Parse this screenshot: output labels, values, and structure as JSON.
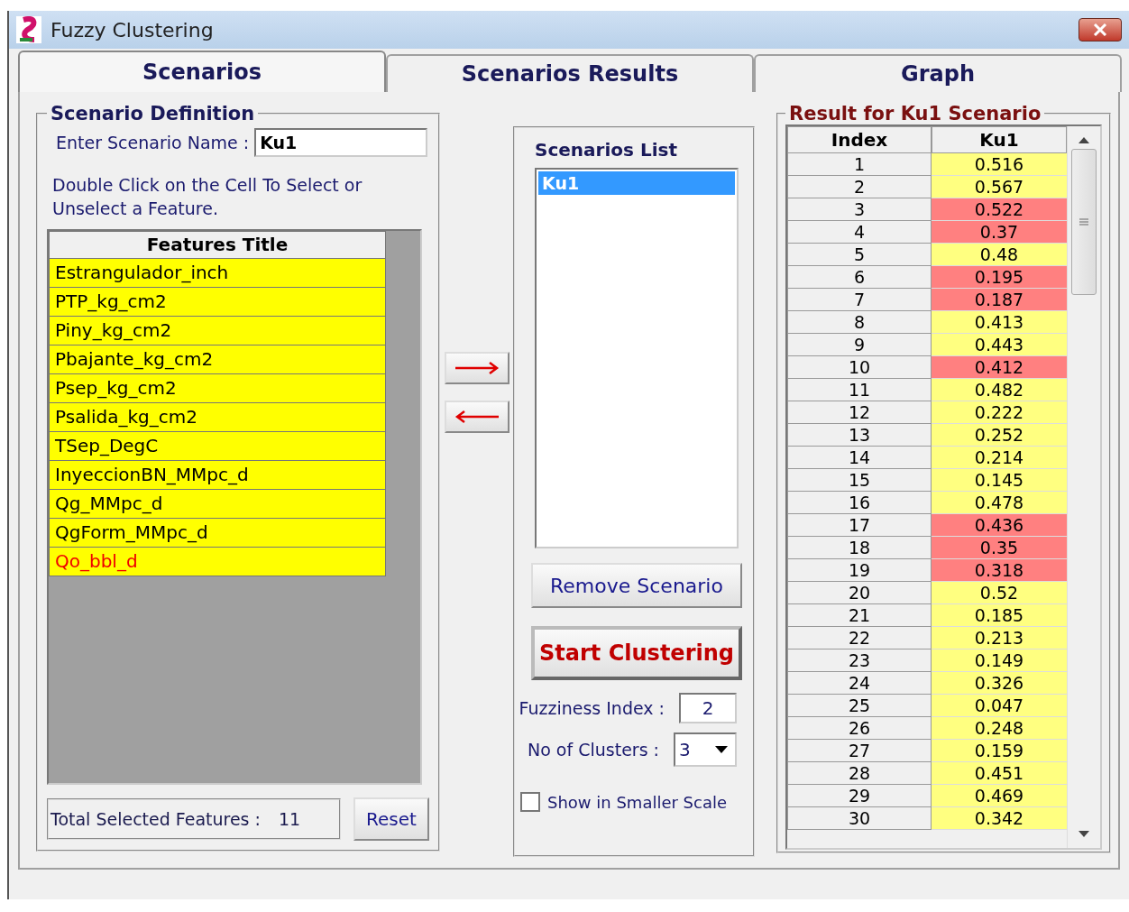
{
  "window": {
    "title": "Fuzzy Clustering"
  },
  "tabs": [
    {
      "label": "Scenarios",
      "selected": true
    },
    {
      "label": "Scenarios Results",
      "selected": false
    },
    {
      "label": "Graph",
      "selected": false
    }
  ],
  "scenario_definition": {
    "title": "Scenario Definition",
    "name_label": "Enter Scenario Name :",
    "name_value": "Ku1",
    "hint": "Double Click on the Cell To Select or Unselect a Feature.",
    "features_header": "Features Title",
    "features": [
      {
        "label": "Estrangulador_inch",
        "target": false
      },
      {
        "label": "PTP_kg_cm2",
        "target": false
      },
      {
        "label": "Piny_kg_cm2",
        "target": false
      },
      {
        "label": "Pbajante_kg_cm2",
        "target": false
      },
      {
        "label": "Psep_kg_cm2",
        "target": false
      },
      {
        "label": "Psalida_kg_cm2",
        "target": false
      },
      {
        "label": "TSep_DegC",
        "target": false
      },
      {
        "label": "InyeccionBN_MMpc_d",
        "target": false
      },
      {
        "label": "Qg_MMpc_d",
        "target": false
      },
      {
        "label": "QgForm_MMpc_d",
        "target": false
      },
      {
        "label": "Qo_bbl_d",
        "target": true
      }
    ],
    "total_label": "Total Selected Features :",
    "total_value": "11",
    "reset_button": "Reset"
  },
  "scenarios_list": {
    "title": "Scenarios List",
    "items": [
      {
        "label": "Ku1",
        "selected": true
      }
    ],
    "remove_button": "Remove Scenario",
    "start_button": "Start Clustering",
    "fuzziness_label": "Fuzziness Index :",
    "fuzziness_value": "2",
    "clusters_label": "No of Clusters :",
    "clusters_value": "3",
    "smaller_scale": {
      "label": "Show in Smaller Scale",
      "checked": false
    }
  },
  "result": {
    "title": "Result for Ku1 Scenario",
    "columns": [
      "Index",
      "Ku1"
    ],
    "rows": [
      {
        "index": "1",
        "value": "0.516",
        "color": "#ffff80"
      },
      {
        "index": "2",
        "value": "0.567",
        "color": "#ffff80"
      },
      {
        "index": "3",
        "value": "0.522",
        "color": "#ff8080"
      },
      {
        "index": "4",
        "value": "0.37",
        "color": "#ff8080"
      },
      {
        "index": "5",
        "value": "0.48",
        "color": "#ffff80"
      },
      {
        "index": "6",
        "value": "0.195",
        "color": "#ff8080"
      },
      {
        "index": "7",
        "value": "0.187",
        "color": "#ff8080"
      },
      {
        "index": "8",
        "value": "0.413",
        "color": "#ffff80"
      },
      {
        "index": "9",
        "value": "0.443",
        "color": "#ffff80"
      },
      {
        "index": "10",
        "value": "0.412",
        "color": "#ff8080"
      },
      {
        "index": "11",
        "value": "0.482",
        "color": "#ffff80"
      },
      {
        "index": "12",
        "value": "0.222",
        "color": "#ffff80"
      },
      {
        "index": "13",
        "value": "0.252",
        "color": "#ffff80"
      },
      {
        "index": "14",
        "value": "0.214",
        "color": "#ffff80"
      },
      {
        "index": "15",
        "value": "0.145",
        "color": "#ffff80"
      },
      {
        "index": "16",
        "value": "0.478",
        "color": "#ffff80"
      },
      {
        "index": "17",
        "value": "0.436",
        "color": "#ff8080"
      },
      {
        "index": "18",
        "value": "0.35",
        "color": "#ff8080"
      },
      {
        "index": "19",
        "value": "0.318",
        "color": "#ff8080"
      },
      {
        "index": "20",
        "value": "0.52",
        "color": "#ffff80"
      },
      {
        "index": "21",
        "value": "0.185",
        "color": "#ffff80"
      },
      {
        "index": "22",
        "value": "0.213",
        "color": "#ffff80"
      },
      {
        "index": "23",
        "value": "0.149",
        "color": "#ffff80"
      },
      {
        "index": "24",
        "value": "0.326",
        "color": "#ffff80"
      },
      {
        "index": "25",
        "value": "0.047",
        "color": "#ffff80"
      },
      {
        "index": "26",
        "value": "0.248",
        "color": "#ffff80"
      },
      {
        "index": "27",
        "value": "0.159",
        "color": "#ffff80"
      },
      {
        "index": "28",
        "value": "0.451",
        "color": "#ffff80"
      },
      {
        "index": "29",
        "value": "0.469",
        "color": "#ffff80"
      },
      {
        "index": "30",
        "value": "0.342",
        "color": "#ffff80"
      }
    ]
  }
}
